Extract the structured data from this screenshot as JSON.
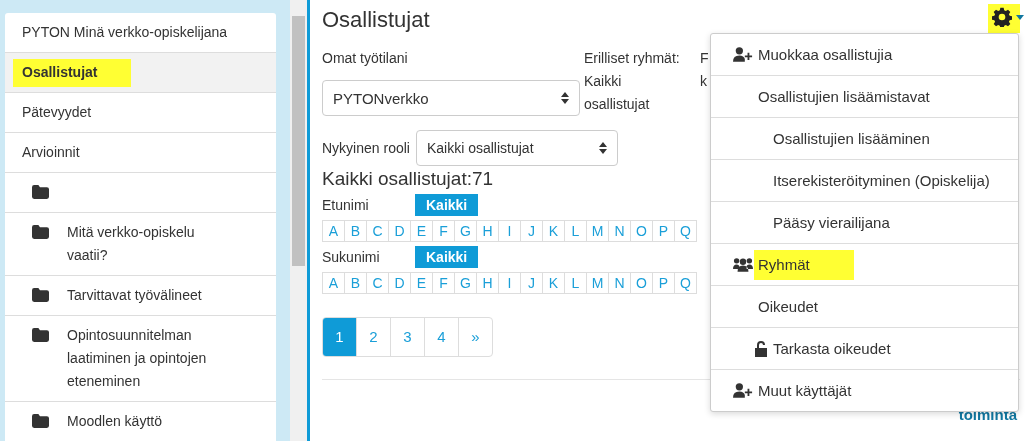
{
  "sidebar": {
    "items": [
      {
        "kind": "link",
        "label": "PYTON Minä verkko-opiskelijana",
        "selected": false,
        "highlighted": false
      },
      {
        "kind": "link",
        "label": "Osallistujat",
        "selected": true,
        "highlighted": true
      },
      {
        "kind": "link",
        "label": "Pätevyydet",
        "selected": false,
        "highlighted": false
      },
      {
        "kind": "link",
        "label": "Arvioinnit",
        "selected": false,
        "highlighted": false
      },
      {
        "kind": "folder",
        "selected": false
      },
      {
        "kind": "folder",
        "label": "Mitä verkko-opiskelu vaatii?",
        "selected": false,
        "highlighted": false
      },
      {
        "kind": "folder",
        "label": "Tarvittavat työvälineet",
        "selected": false,
        "highlighted": false
      },
      {
        "kind": "folder",
        "label": "Opintosuunnitelman laatiminen ja opintojen eteneminen",
        "selected": false,
        "highlighted": false
      },
      {
        "kind": "folder",
        "label": "Moodlen käyttö",
        "selected": false,
        "highlighted": false
      }
    ]
  },
  "page": {
    "title": "Osallistujat",
    "settings_highlighted": true
  },
  "filters": {
    "workspace_label": "Omat työtilani",
    "workspace_value": "PYTONverkko",
    "groups_label": "Erilliset ryhmät:",
    "groups_value": "Kaikki osallistujat",
    "column_3_label": [
      "F",
      "k"
    ],
    "role_label": "Nykyinen rooli",
    "role_value": "Kaikki osallistujat"
  },
  "count": "Kaikki osallistujat:71",
  "initials_bars": [
    {
      "label": "Etunimi",
      "all": "Kaikki",
      "letters": [
        "A",
        "B",
        "C",
        "D",
        "E",
        "F",
        "G",
        "H",
        "I",
        "J",
        "K",
        "L",
        "M",
        "N",
        "O",
        "P",
        "Q"
      ]
    },
    {
      "label": "Sukunimi",
      "all": "Kaikki",
      "letters": [
        "A",
        "B",
        "C",
        "D",
        "E",
        "F",
        "G",
        "H",
        "I",
        "J",
        "K",
        "L",
        "M",
        "N",
        "O",
        "P",
        "Q"
      ]
    }
  ],
  "pagination": [
    {
      "label": "1",
      "selected": true
    },
    {
      "label": "2",
      "selected": false
    },
    {
      "label": "3",
      "selected": false
    },
    {
      "label": "4",
      "selected": false
    },
    {
      "label": "»",
      "selected": false
    }
  ],
  "right_link": "toiminta",
  "settings_menu": [
    {
      "label": "Muokkaa osallistujia",
      "kind": "enrol",
      "highlighted": false
    },
    {
      "label": "Osallistujien lisäämistavat",
      "highlighted": false,
      "children": [
        {
          "label": "Osallistujien lisääminen",
          "highlighted": false
        },
        {
          "label": "Itserekisteröityminen (Opiskelija)",
          "highlighted": false
        },
        {
          "label": "Pääsy vierailijana",
          "highlighted": false
        }
      ]
    },
    {
      "label": "Ryhmät",
      "kind": "groups",
      "highlighted": true
    },
    {
      "label": "Oikeudet",
      "highlighted": false,
      "children": [
        {
          "label": "Tarkasta oikeudet",
          "kind": "check",
          "highlighted": false
        }
      ]
    },
    {
      "label": "Muut käyttäjät",
      "kind": "enrol",
      "highlighted": false
    }
  ]
}
